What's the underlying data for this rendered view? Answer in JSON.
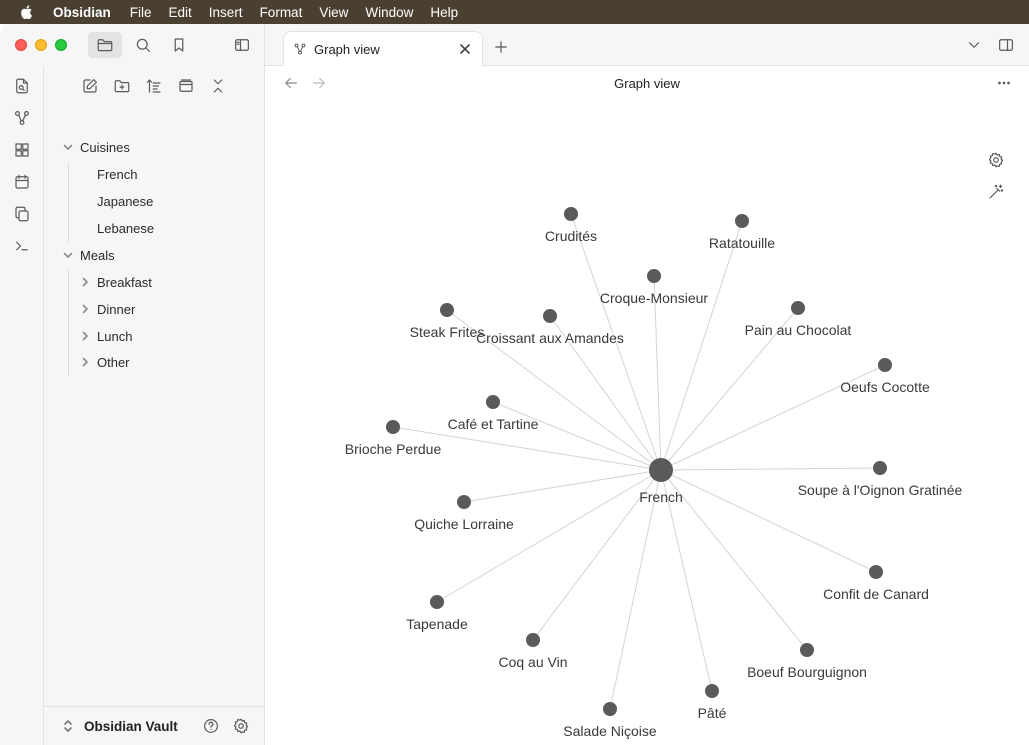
{
  "menubar": {
    "app": "Obsidian",
    "items": [
      "File",
      "Edit",
      "Insert",
      "Format",
      "View",
      "Window",
      "Help"
    ]
  },
  "sidebar": {
    "tree": [
      {
        "label": "Cuisines",
        "kind": "folder",
        "expanded": true,
        "depth": 0
      },
      {
        "label": "French",
        "kind": "file",
        "depth": 1
      },
      {
        "label": "Japanese",
        "kind": "file",
        "depth": 1
      },
      {
        "label": "Lebanese",
        "kind": "file",
        "depth": 1
      },
      {
        "label": "Meals",
        "kind": "folder",
        "expanded": true,
        "depth": 0
      },
      {
        "label": "Breakfast",
        "kind": "folder",
        "expanded": false,
        "depth": 1
      },
      {
        "label": "Dinner",
        "kind": "folder",
        "expanded": false,
        "depth": 1
      },
      {
        "label": "Lunch",
        "kind": "folder",
        "expanded": false,
        "depth": 1
      },
      {
        "label": "Other",
        "kind": "folder",
        "expanded": false,
        "depth": 1
      }
    ],
    "vault_name": "Obsidian Vault"
  },
  "tab": {
    "label": "Graph view"
  },
  "view": {
    "title": "Graph view"
  },
  "graph": {
    "center": "French",
    "nodes": [
      "Crudités",
      "Ratatouille",
      "Croque-Monsieur",
      "Steak Frites",
      "Croissant aux Amandes",
      "Pain au Chocolat",
      "Oeufs Cocotte",
      "Café et Tartine",
      "Brioche Perdue",
      "Soupe à l'Oignon Gratinée",
      "Quiche Lorraine",
      "Confit de Canard",
      "Tapenade",
      "Coq au Vin",
      "Boeuf Bourguignon",
      "Pâté",
      "Salade Niçoise"
    ],
    "node_color": "#5a5a5a",
    "edge_color": "#d4d4d4"
  }
}
